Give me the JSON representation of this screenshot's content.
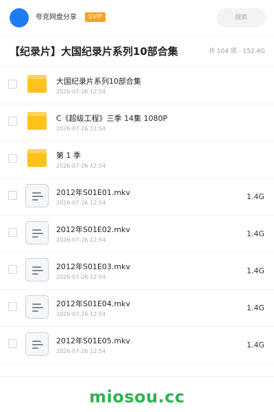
{
  "header": {
    "site_name": "夸克网盘分享",
    "badge": "SVIP",
    "search_label": "搜索",
    "accent_color": "#1e7cf2",
    "badge_color": "#f7a21a"
  },
  "title_bar": {
    "title": "【纪录片】大国纪录片系列10部合集",
    "stats": "共 104 项 · 152.4G"
  },
  "items": [
    {
      "type": "folder",
      "icon": "folder-icon",
      "name": "大国纪录片系列10部合集",
      "date": "2026-07-26 12:54",
      "size": ""
    },
    {
      "type": "folder",
      "icon": "folder-icon",
      "name": "C《超级工程》三季 14集 1080P",
      "date": "2026-07-26 12:54",
      "size": ""
    },
    {
      "type": "folder",
      "icon": "folder-icon",
      "name": "第 1 季",
      "date": "2026-07-26 12:54",
      "size": ""
    },
    {
      "type": "file",
      "icon": "file-icon",
      "name": "2012年S01E01.mkv",
      "date": "2026-07-26 12:54",
      "size": "1.4G"
    },
    {
      "type": "file",
      "icon": "file-icon",
      "name": "2012年S01E02.mkv",
      "date": "2026-07-26 12:54",
      "size": "1.4G"
    },
    {
      "type": "file",
      "icon": "file-icon",
      "name": "2012年S01E03.mkv",
      "date": "2026-07-26 12:54",
      "size": "1.4G"
    },
    {
      "type": "file",
      "icon": "file-icon",
      "name": "2012年S01E04.mkv",
      "date": "2026-07-26 12:54",
      "size": "1.4G"
    },
    {
      "type": "file",
      "icon": "file-icon",
      "name": "2012年S01E05.mkv",
      "date": "2026-07-26 12:54",
      "size": "1.4G"
    }
  ],
  "footer": {
    "brand": "miosou.cc",
    "brand_color": "#2fb34f"
  }
}
